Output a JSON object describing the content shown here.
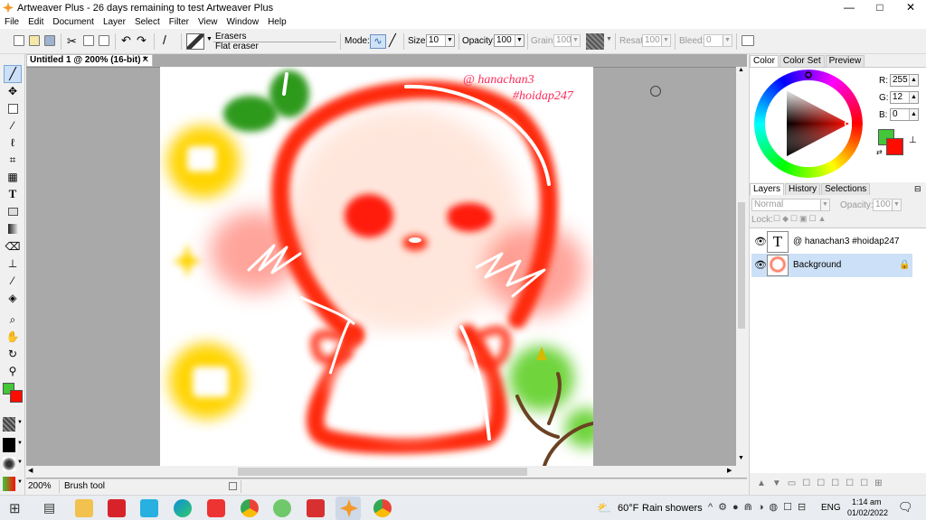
{
  "window": {
    "title": "Artweaver Plus - 26 days remaining to test Artweaver Plus",
    "min": "—",
    "max": "□",
    "close": "✕"
  },
  "menu": [
    "File",
    "Edit",
    "Document",
    "Layer",
    "Select",
    "Filter",
    "View",
    "Window",
    "Help"
  ],
  "toolbar": {
    "brush_category": "Erasers",
    "brush_name": "Flat eraser",
    "mode_label": "Mode:",
    "size_label": "Size:",
    "size_value": "10",
    "opacity_label": "Opacity:",
    "opacity_value": "100",
    "grain_label": "Grain:",
    "grain_value": "100",
    "resat_label": "Resat:",
    "resat_value": "100",
    "bleed_label": "Bleed:",
    "bleed_value": "0"
  },
  "document": {
    "tab_title": "Untitled 1 @ 200% (16-bit) *",
    "tab_close": "✕",
    "watermark_line1": "@ hanachan3",
    "watermark_line2": "#hoidap247"
  },
  "status": {
    "zoom": "200%",
    "tool": "Brush tool"
  },
  "color_panel": {
    "tabs": [
      "Color",
      "Color Set",
      "Preview"
    ],
    "active_tab": "Color",
    "r_label": "R:",
    "r_value": "255",
    "g_label": "G:",
    "g_value": "12",
    "b_label": "B:",
    "b_value": "0",
    "foreground": "#43c638",
    "background": "#ff0c00"
  },
  "layers_panel": {
    "tabs": [
      "Layers",
      "History",
      "Selections"
    ],
    "active_tab": "Layers",
    "blend_mode": "Normal",
    "opacity_label": "Opacity:",
    "opacity_value": "100",
    "lock_label": "Lock:",
    "layers": [
      {
        "name": "@ hanachan3 #hoidap247",
        "thumb": "T",
        "selected": false
      },
      {
        "name": "Background",
        "thumb": "",
        "selected": true
      }
    ]
  },
  "taskbar": {
    "weather_temp": "60°F",
    "weather_text": "Rain showers",
    "language": "ENG",
    "time": "1:14 am",
    "date": "01/02/2022"
  }
}
